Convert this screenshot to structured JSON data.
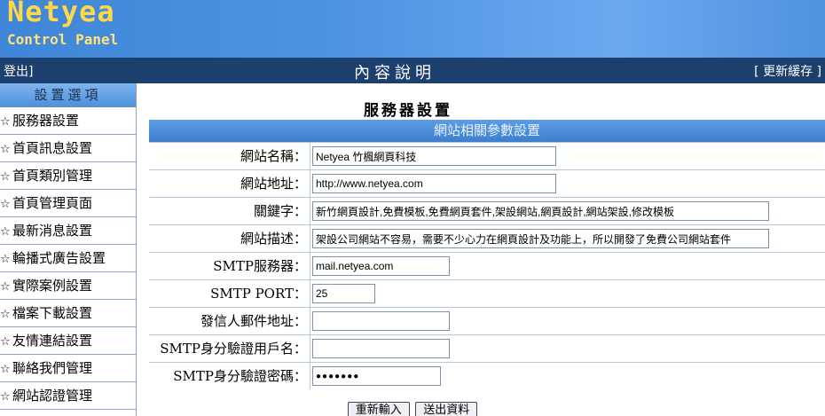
{
  "brand": {
    "name": "Netyea",
    "subtitle": "Control Panel"
  },
  "topbar": {
    "logout": "登出]",
    "title": "內容說明",
    "refresh": "[ 更新緩存 ]"
  },
  "sidebar": {
    "header": "設置選項",
    "items": [
      {
        "label": "服務器設置"
      },
      {
        "label": "首頁訊息設置"
      },
      {
        "label": "首頁類別管理"
      },
      {
        "label": "首頁管理頁面"
      },
      {
        "label": "最新消息設置"
      },
      {
        "label": "輪播式廣告設置"
      },
      {
        "label": "實際案例設置"
      },
      {
        "label": "檔案下載設置"
      },
      {
        "label": "友情連結設置"
      },
      {
        "label": "聯絡我們管理"
      },
      {
        "label": "網站認證管理"
      }
    ]
  },
  "main": {
    "title": "服務器設置",
    "form_header": "網站相關參數設置",
    "fields": [
      {
        "label": "網站名稱：",
        "value": "Netyea 竹楓網頁科技"
      },
      {
        "label": "網站地址：",
        "value": "http://www.netyea.com"
      },
      {
        "label": "關鍵字：",
        "value": "新竹網頁設計,免費模板,免費網頁套件,架設網站,網頁設計,網站架設,修改模板"
      },
      {
        "label": "網站描述：",
        "value": "架設公司網站不容易，需要不少心力在網頁設計及功能上，所以開發了免費公司網站套件"
      },
      {
        "label": "SMTP服務器：",
        "value": "mail.netyea.com"
      },
      {
        "label": "SMTP PORT：",
        "value": "25"
      },
      {
        "label": "發信人郵件地址：",
        "value": ""
      },
      {
        "label": "SMTP身分驗證用戶名：",
        "value": ""
      },
      {
        "label": "SMTP身分驗證密碼：",
        "value": "●●●●●●●"
      }
    ],
    "buttons": {
      "reset": "重新輸入",
      "submit": "送出資料"
    }
  }
}
